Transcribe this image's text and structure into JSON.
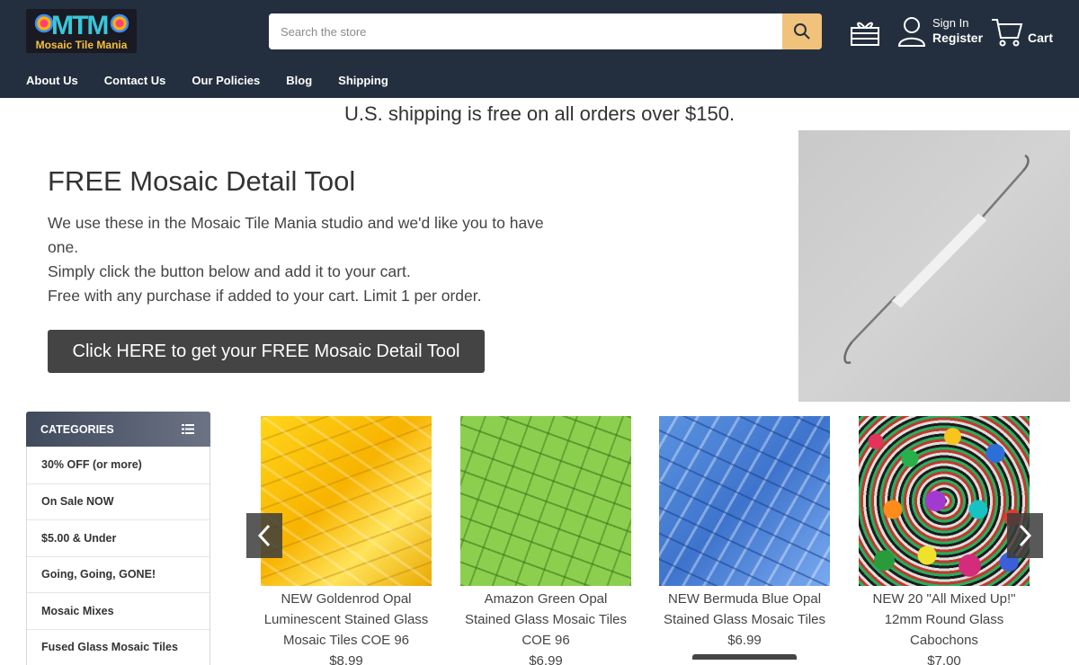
{
  "header": {
    "logo_text": "Mosaic Tile Mania",
    "logo_mark": "MTM",
    "search_placeholder": "Search the store",
    "sign_in_label": "Sign In",
    "register_label": "Register",
    "cart_label": "Cart",
    "nav": [
      {
        "label": "About Us"
      },
      {
        "label": "Contact Us"
      },
      {
        "label": "Our Policies"
      },
      {
        "label": "Blog"
      },
      {
        "label": "Shipping"
      }
    ],
    "colors": {
      "background": "#232f3e",
      "search_button": "#f0c27b"
    }
  },
  "banner": {
    "shipping_text": "U.S. shipping is free on all orders over $150."
  },
  "promo": {
    "title": "FREE Mosaic Detail Tool",
    "lines": [
      "We use these in the Mosaic Tile Mania studio and we'd like you to have one.",
      "Simply click the button below and add it to your cart.",
      "Free with any purchase if added to your cart. Limit 1 per order."
    ],
    "button_label": "Click HERE to get your FREE Mosaic Detail Tool"
  },
  "categories": {
    "title": "CATEGORIES",
    "items": [
      {
        "label": "30% OFF (or more)"
      },
      {
        "label": "On Sale NOW"
      },
      {
        "label": "$5.00 & Under"
      },
      {
        "label": "Going, Going, GONE!"
      },
      {
        "label": "Mosaic Mixes"
      },
      {
        "label": "Fused Glass Mosaic Tiles"
      }
    ]
  },
  "products": [
    {
      "title": "NEW Goldenrod Opal Luminescent Stained Glass Mosaic Tiles COE 96",
      "price": "$8.99",
      "image": "yellow-glass-tiles"
    },
    {
      "title": "Amazon Green Opal Stained Glass Mosaic Tiles COE 96",
      "price": "$6.99",
      "image": "green-glass-tiles"
    },
    {
      "title": "NEW Bermuda Blue Opal Stained Glass Mosaic Tiles",
      "price": "$6.99",
      "image": "blue-glass-tiles"
    },
    {
      "title": "NEW 20 \"All Mixed Up!\" 12mm Round Glass Cabochons",
      "price": "$7.00",
      "image": "mixed-glass-cabochons"
    }
  ]
}
